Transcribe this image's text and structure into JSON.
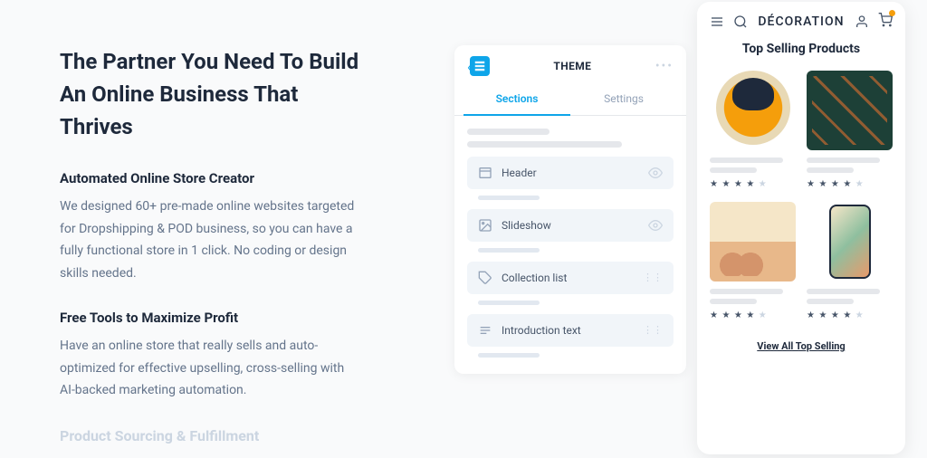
{
  "headline": "The Partner You Need To Build An Online Business That Thrives",
  "features": [
    {
      "title": "Automated Online Store Creator",
      "body": "We designed 60+ pre-made online websites targeted for Dropshipping & POD business, so you can have a fully functional store in 1 click. No coding or design skills needed."
    },
    {
      "title": "Free Tools to Maximize Profit",
      "body": "Have an online store that really sells and auto-optimized for effective upselling, cross-selling with AI-backed marketing automation."
    }
  ],
  "faded_feature": "Product Sourcing & Fulfillment",
  "theme_panel": {
    "title": "THEME",
    "tabs": [
      "Sections",
      "Settings"
    ],
    "active_tab": 0,
    "sections": [
      {
        "label": "Header",
        "icon": "layout",
        "trailing": "eye"
      },
      {
        "label": "Slideshow",
        "icon": "image",
        "trailing": "eye"
      },
      {
        "label": "Collection list",
        "icon": "tag",
        "trailing": "handle"
      },
      {
        "label": "Introduction text",
        "icon": "text",
        "trailing": "handle"
      }
    ]
  },
  "phone": {
    "brand": "DÉCORATION",
    "title": "Top Selling Products",
    "view_all": "View All Top Selling",
    "products": [
      {
        "rating": 4,
        "img": "clock"
      },
      {
        "rating": 4,
        "img": "pillow"
      },
      {
        "rating": 4,
        "img": "art"
      },
      {
        "rating": 4,
        "img": "phonecase"
      }
    ]
  }
}
